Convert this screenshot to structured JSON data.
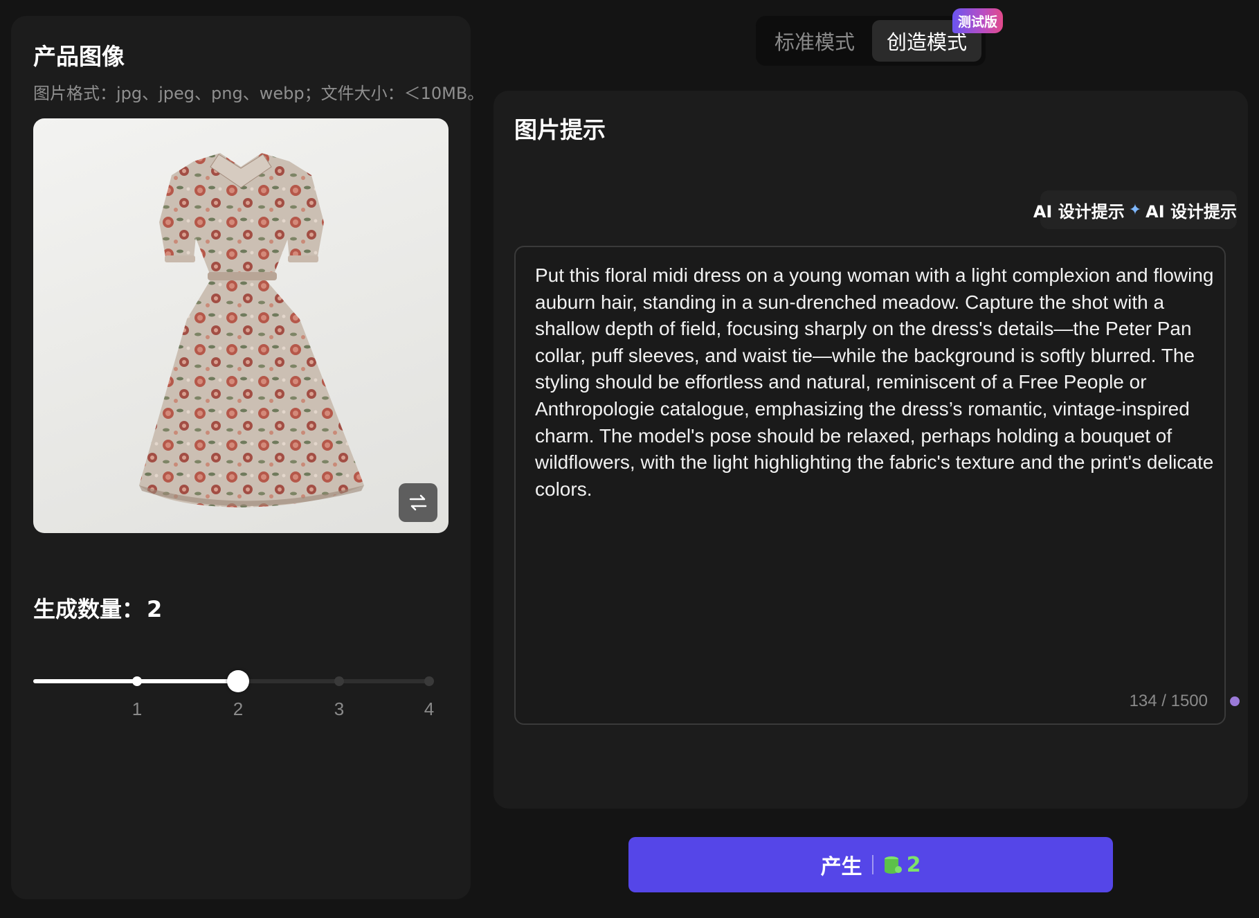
{
  "left_panel": {
    "title": "产品图像",
    "hint": "图片格式：jpg、jpeg、png、webp；文件大小：＜10MB。",
    "image_subject": "floral-midi-dress",
    "swap_icon": "swap-arrows-icon",
    "count_label": "生成数量：",
    "count_value": "2",
    "slider": {
      "min": 1,
      "max": 4,
      "value": 2,
      "ticks": [
        "1",
        "2",
        "3",
        "4"
      ]
    }
  },
  "mode_switch": {
    "standard_label": "标准模式",
    "creative_label": "创造模式",
    "selected": "创造模式",
    "beta_badge": "测试版"
  },
  "right_panel": {
    "title": "图片提示",
    "ai_button_label": "AI 设计提示",
    "ai_button_label_2": "AI 设计提示",
    "sparkle_icon": "sparkle-icon",
    "prompt_text": "Put this floral midi dress on a young woman with a light complexion and flowing auburn hair, standing in a sun-drenched meadow. Capture the shot with a shallow depth of field, focusing sharply on the dress's details—the Peter Pan collar, puff sleeves, and waist tie—while the background is softly blurred. The styling should be effortless and natural, reminiscent of a Free People or Anthropologie catalogue, emphasizing the dress’s romantic, vintage-inspired charm. The model's pose should be relaxed, perhaps holding a bouquet of wildflowers, with the light highlighting the fabric's texture and the print's delicate colors.",
    "char_count": "134 / 1500"
  },
  "generate": {
    "label": "产生",
    "cost": "2",
    "coin_icon": "coins-icon"
  },
  "colors": {
    "background": "#141414",
    "panel": "#1c1c1c",
    "accent": "#5546e8",
    "cost_green": "#7ee26b"
  }
}
